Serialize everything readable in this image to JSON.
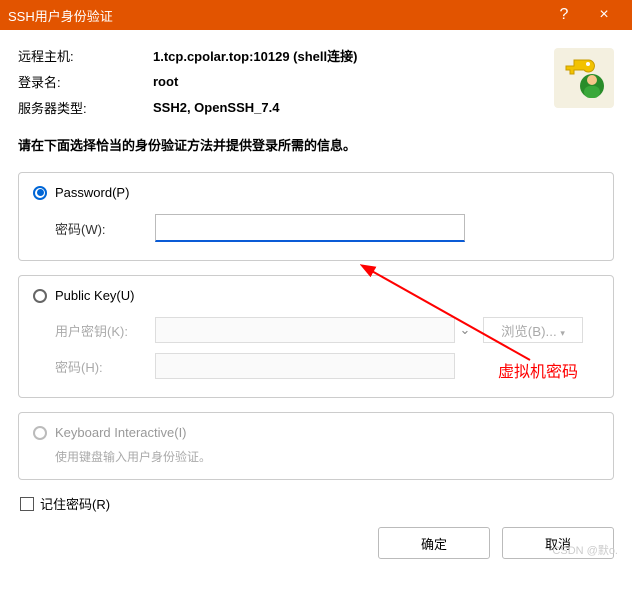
{
  "titlebar": {
    "title": "SSH用户身份验证",
    "help": "?",
    "close": "×"
  },
  "info": {
    "remote_host_label": "远程主机:",
    "remote_host_value": "1.tcp.cpolar.top:10129 (shell连接)",
    "login_name_label": "登录名:",
    "login_name_value": "root",
    "server_type_label": "服务器类型:",
    "server_type_value": "SSH2, OpenSSH_7.4"
  },
  "instruction": "请在下面选择恰当的身份验证方法并提供登录所需的信息。",
  "password_group": {
    "radio_label": "Password(P)",
    "field_label": "密码(W):",
    "value": ""
  },
  "pubkey_group": {
    "radio_label": "Public Key(U)",
    "user_key_label": "用户密钥(K):",
    "browse_label": "浏览(B)...",
    "password_label": "密码(H):"
  },
  "keyboard_group": {
    "radio_label": "Keyboard Interactive(I)",
    "sub_text": "使用键盘输入用户身份验证。"
  },
  "remember_label": "记住密码(R)",
  "actions": {
    "ok": "确定",
    "cancel": "取消"
  },
  "annotation": "虚拟机密码",
  "watermark": "CSDN @默o."
}
